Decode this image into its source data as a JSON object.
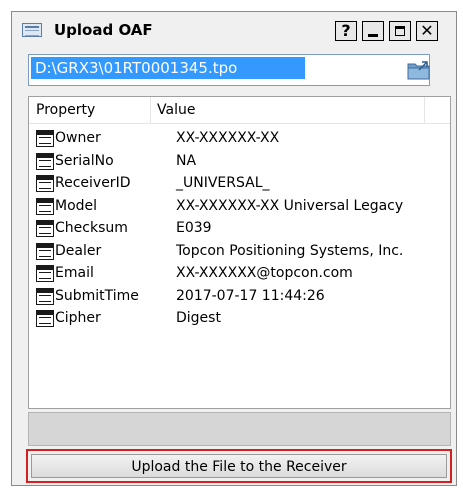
{
  "window": {
    "title": "Upload OAF",
    "help_label": "?",
    "close_label": "✕"
  },
  "file": {
    "path": "D:\\GRX3\\01RT0001345.tpo"
  },
  "properties": {
    "header_property": "Property",
    "header_value": "Value",
    "rows": [
      {
        "property": "Owner",
        "value": "XX-XXXXXX-XX"
      },
      {
        "property": "SerialNo",
        "value": "NA"
      },
      {
        "property": "ReceiverID",
        "value": "_UNIVERSAL_"
      },
      {
        "property": "Model",
        "value": "XX-XXXXXX-XX Universal Legacy"
      },
      {
        "property": "Checksum",
        "value": "E039"
      },
      {
        "property": "Dealer",
        "value": "Topcon Positioning Systems, Inc."
      },
      {
        "property": "Email",
        "value": "XX-XXXXXX@topcon.com"
      },
      {
        "property": "SubmitTime",
        "value": "2017-07-17 11:44:26"
      },
      {
        "property": "Cipher",
        "value": "Digest"
      }
    ]
  },
  "actions": {
    "upload_label": "Upload the File to the Receiver"
  },
  "colors": {
    "selection": "#3399ff",
    "highlight": "#d42020"
  }
}
